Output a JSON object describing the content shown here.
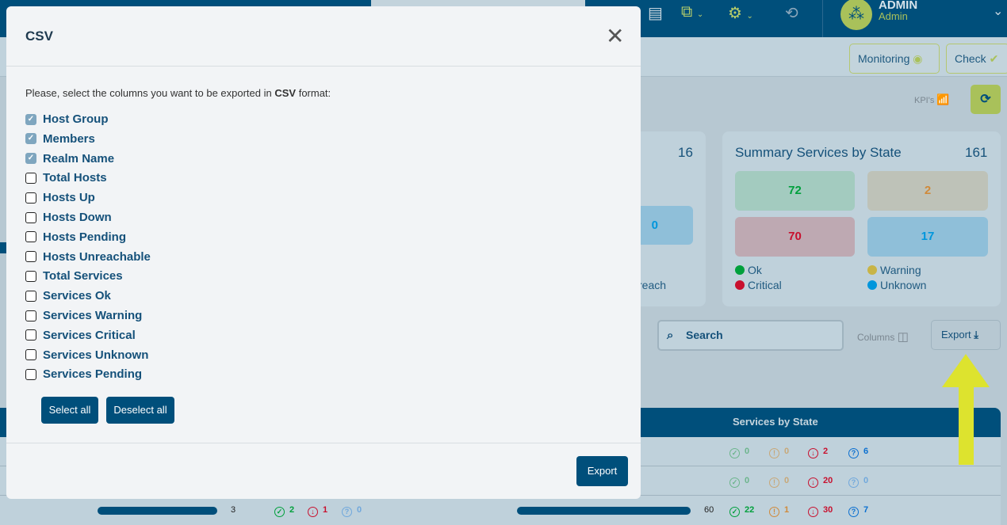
{
  "topbar": {
    "user_name": "ADMIN",
    "user_role": "Admin"
  },
  "toolbar": {
    "monitoring": "Monitoring",
    "check": "Check",
    "kpis": "KPI's"
  },
  "hosts_card": {
    "total": "16",
    "tile_value": "0",
    "legend_partial": "reach"
  },
  "services_card": {
    "title": "Summary Services by State",
    "total": "161",
    "tiles": [
      {
        "label": "Ok",
        "value": "72",
        "color": "#00a03c"
      },
      {
        "label": "Warning",
        "value": "2",
        "color": "#c8b446"
      },
      {
        "label": "Critical",
        "value": "70",
        "color": "#c8102e"
      },
      {
        "label": "Unknown",
        "value": "17",
        "color": "#0096dc"
      }
    ]
  },
  "search": {
    "placeholder": "Search"
  },
  "columns_label": "Columns",
  "export_label": "Export",
  "table": {
    "header": "Services by State",
    "rows": [
      {
        "ok": "0",
        "warning": "0",
        "critical": "2",
        "unknown": "6"
      },
      {
        "ok": "0",
        "warning": "0",
        "critical": "20",
        "unknown": "0"
      },
      {
        "hosts_total": "3",
        "hosts_up": "2",
        "hosts_down": "1",
        "hosts_unknown": "0",
        "services_total": "60",
        "ok": "22",
        "warning": "1",
        "critical": "30",
        "unknown": "7"
      }
    ]
  },
  "modal": {
    "title": "CSV",
    "intro_pre": "Please, select the columns you want to be exported in ",
    "intro_bold": "CSV",
    "intro_post": " format:",
    "columns": [
      {
        "label": "Host Group",
        "checked": true
      },
      {
        "label": "Members",
        "checked": true
      },
      {
        "label": "Realm Name",
        "checked": true
      },
      {
        "label": "Total Hosts",
        "checked": false
      },
      {
        "label": "Hosts Up",
        "checked": false
      },
      {
        "label": "Hosts Down",
        "checked": false
      },
      {
        "label": "Hosts Pending",
        "checked": false
      },
      {
        "label": "Hosts Unreachable",
        "checked": false
      },
      {
        "label": "Total Services",
        "checked": false
      },
      {
        "label": "Services Ok",
        "checked": false
      },
      {
        "label": "Services Warning",
        "checked": false
      },
      {
        "label": "Services Critical",
        "checked": false
      },
      {
        "label": "Services Unknown",
        "checked": false
      },
      {
        "label": "Services Pending",
        "checked": false
      }
    ],
    "select_all": "Select all",
    "deselect_all": "Deselect all",
    "export": "Export"
  }
}
